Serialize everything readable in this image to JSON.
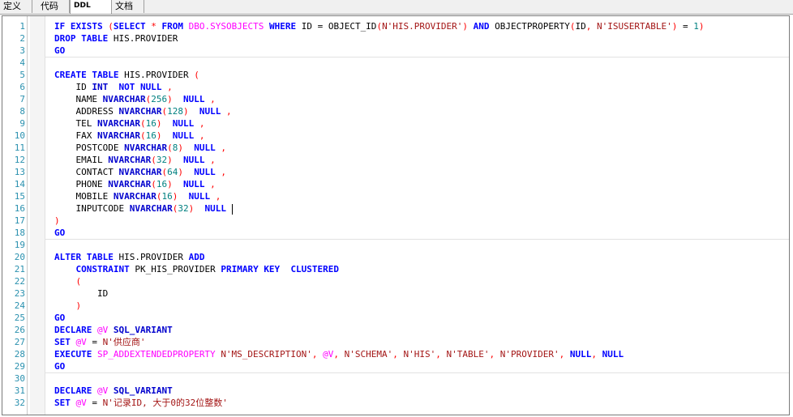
{
  "tabs": [
    {
      "label": "定义",
      "active": false
    },
    {
      "label": "代码",
      "active": false
    },
    {
      "label": "DDL",
      "active": true
    },
    {
      "label": "文档",
      "active": false
    }
  ],
  "editor": {
    "lines": [
      {
        "n": "1",
        "t": "IF EXISTS (SELECT * FROM DBO.SYSOBJECTS WHERE ID = OBJECT_ID(N'HIS.PROVIDER') AND OBJECTPROPERTY(ID, N'ISUSERTABLE') = 1)"
      },
      {
        "n": "2",
        "t": "DROP TABLE HIS.PROVIDER"
      },
      {
        "n": "3",
        "t": "GO"
      },
      {
        "n": "4",
        "t": ""
      },
      {
        "n": "5",
        "t": "CREATE TABLE HIS.PROVIDER ("
      },
      {
        "n": "6",
        "t": "    ID INT  NOT NULL ,"
      },
      {
        "n": "7",
        "t": "    NAME NVARCHAR(256)  NULL ,"
      },
      {
        "n": "8",
        "t": "    ADDRESS NVARCHAR(128)  NULL ,"
      },
      {
        "n": "9",
        "t": "    TEL NVARCHAR(16)  NULL ,"
      },
      {
        "n": "10",
        "t": "    FAX NVARCHAR(16)  NULL ,"
      },
      {
        "n": "11",
        "t": "    POSTCODE NVARCHAR(8)  NULL ,"
      },
      {
        "n": "12",
        "t": "    EMAIL NVARCHAR(32)  NULL ,"
      },
      {
        "n": "13",
        "t": "    CONTACT NVARCHAR(64)  NULL ,"
      },
      {
        "n": "14",
        "t": "    PHONE NVARCHAR(16)  NULL ,"
      },
      {
        "n": "15",
        "t": "    MOBILE NVARCHAR(16)  NULL ,"
      },
      {
        "n": "16",
        "t": "    INPUTCODE NVARCHAR(32)  NULL "
      },
      {
        "n": "17",
        "t": ")"
      },
      {
        "n": "18",
        "t": "GO"
      },
      {
        "n": "19",
        "t": ""
      },
      {
        "n": "20",
        "t": "ALTER TABLE HIS.PROVIDER ADD"
      },
      {
        "n": "21",
        "t": "    CONSTRAINT PK_HIS_PROVIDER PRIMARY KEY  CLUSTERED"
      },
      {
        "n": "22",
        "t": "    ("
      },
      {
        "n": "23",
        "t": "        ID"
      },
      {
        "n": "24",
        "t": "    )"
      },
      {
        "n": "25",
        "t": "GO"
      },
      {
        "n": "26",
        "t": "DECLARE @V SQL_VARIANT"
      },
      {
        "n": "27",
        "t": "SET @V = N'供应商'"
      },
      {
        "n": "28",
        "t": "EXECUTE SP_ADDEXTENDEDPROPERTY N'MS_DESCRIPTION', @V, N'SCHEMA', N'HIS', N'TABLE', N'PROVIDER', NULL, NULL"
      },
      {
        "n": "29",
        "t": "GO"
      },
      {
        "n": "30",
        "t": ""
      },
      {
        "n": "31",
        "t": "DECLARE @V SQL_VARIANT"
      },
      {
        "n": "32",
        "t": "SET @V = N'记录ID, 大于0的32位整数'"
      }
    ],
    "cursor_line": "16",
    "separator_after": [
      "3",
      "18",
      "29"
    ]
  },
  "colors": {
    "keyword": "#0000ff",
    "string": "#a31515",
    "system_object": "#ff00ff",
    "number": "#008080",
    "line_number": "#2b91af"
  }
}
